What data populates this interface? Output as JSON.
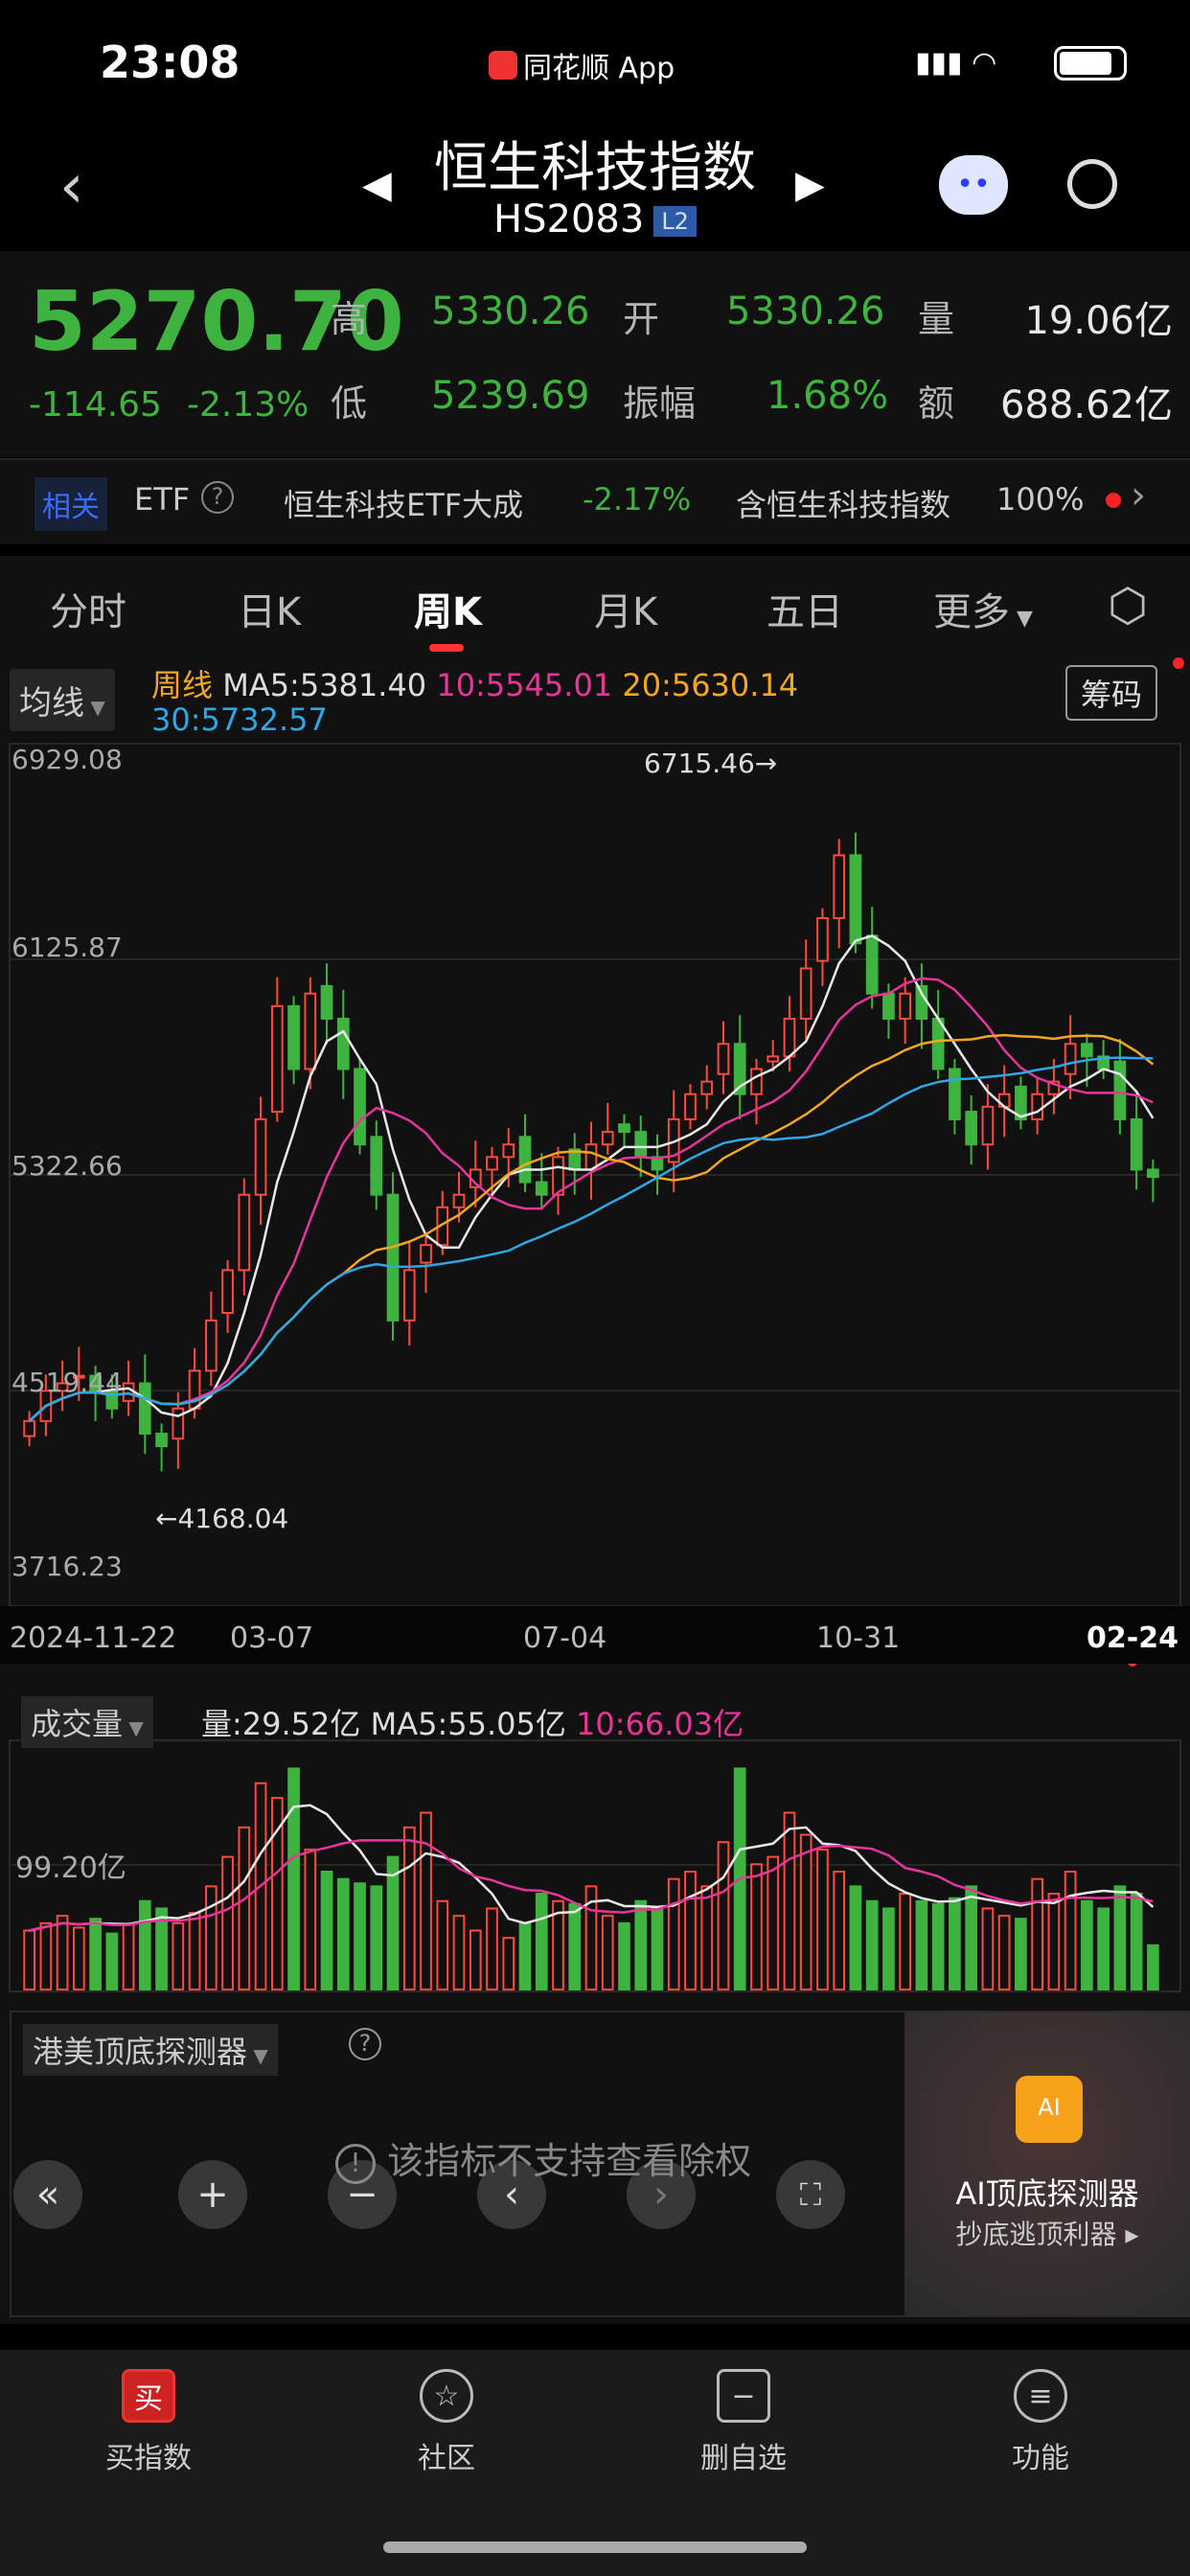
{
  "status": {
    "time": "23:08",
    "app": "同花顺 App"
  },
  "header": {
    "title": "恒生科技指数",
    "code": "HS2083",
    "badge": "L2"
  },
  "quote": {
    "price": "5270.70",
    "change": "-114.65",
    "change_pct": "-2.13%",
    "high_label": "高",
    "high": "5330.26",
    "open_label": "开",
    "open": "5330.26",
    "vol_label": "量",
    "vol": "19.06亿",
    "low_label": "低",
    "low": "5239.69",
    "amp_label": "振幅",
    "amp": "1.68%",
    "amt_label": "额",
    "amt": "688.62亿"
  },
  "etf": {
    "tag": "相关",
    "label": "ETF",
    "name": "恒生科技ETF大成",
    "pct": "-2.17%",
    "contain": "含恒生科技指数",
    "ratio": "100%"
  },
  "tabs": [
    "分时",
    "日K",
    "周K",
    "月K",
    "五日",
    "更多"
  ],
  "active_tab": 2,
  "ma": {
    "select": "均线",
    "period": "周线",
    "ma5": "MA5:5381.40",
    "ma10": "10:5545.01",
    "ma20": "20:5630.14",
    "ma30": "30:5732.57",
    "chip": "筹码"
  },
  "colors": {
    "up": "#ff4a3d",
    "down": "#3fb33f",
    "ma5": "#e8e8e8",
    "ma10": "#e8359a",
    "ma20": "#f5a623",
    "ma30": "#2fa7e6"
  },
  "chart_data": {
    "type": "candlestick",
    "ylim": [
      3716.23,
      6929.08
    ],
    "y_ticks": [
      "6929.08",
      "6125.87",
      "5322.66",
      "4519.44",
      "3716.23"
    ],
    "max_label": "6715.46→",
    "min_label": "←4168.04",
    "x_labels": [
      "2024-11-22",
      "03-07",
      "07-04",
      "10-31",
      "02-24"
    ],
    "closes": [
      4300,
      4420,
      4450,
      4480,
      4420,
      4350,
      4450,
      4250,
      4200,
      4350,
      4500,
      4700,
      4900,
      5200,
      5500,
      5950,
      5700,
      6000,
      5900,
      5700,
      5400,
      5200,
      4700,
      4900,
      5000,
      5150,
      5200,
      5300,
      5350,
      5400,
      5250,
      5200,
      5350,
      5300,
      5400,
      5450,
      5450,
      5350,
      5300,
      5500,
      5600,
      5650,
      5800,
      5600,
      5700,
      5750,
      5900,
      6100,
      6300,
      6550,
      6200,
      6000,
      5900,
      6000,
      5900,
      5700,
      5500,
      5400,
      5550,
      5600,
      5500,
      5600,
      5650,
      5800,
      5750,
      5700,
      5500,
      5300,
      5270.7
    ],
    "volume": {
      "select": "成交量",
      "vol": "量:29.52亿",
      "ma5": "MA5:55.05亿",
      "ma10": "10:66.03亿",
      "tick": "99.20亿",
      "ymax": 160,
      "values": [
        40,
        45,
        50,
        42,
        48,
        38,
        44,
        60,
        55,
        45,
        52,
        70,
        90,
        110,
        140,
        130,
        150,
        95,
        80,
        75,
        72,
        70,
        90,
        110,
        120,
        60,
        50,
        40,
        55,
        35,
        45,
        65,
        60,
        58,
        70,
        50,
        45,
        60,
        55,
        75,
        80,
        70,
        100,
        150,
        85,
        90,
        120,
        105,
        95,
        80,
        70,
        60,
        55,
        65,
        60,
        58,
        62,
        70,
        55,
        50,
        48,
        75,
        65,
        80,
        60,
        55,
        70,
        65,
        30
      ]
    }
  },
  "indicator": {
    "select": "港美顶底探测器",
    "notice": "该指标不支持查看除权",
    "ai_title": "AI顶底探测器",
    "ai_sub": "抄底逃顶利器"
  },
  "bottom_nav": [
    {
      "label": "买指数",
      "icon": "买"
    },
    {
      "label": "社区",
      "icon": "☆"
    },
    {
      "label": "删自选",
      "icon": "−"
    },
    {
      "label": "功能",
      "icon": "≡"
    }
  ]
}
